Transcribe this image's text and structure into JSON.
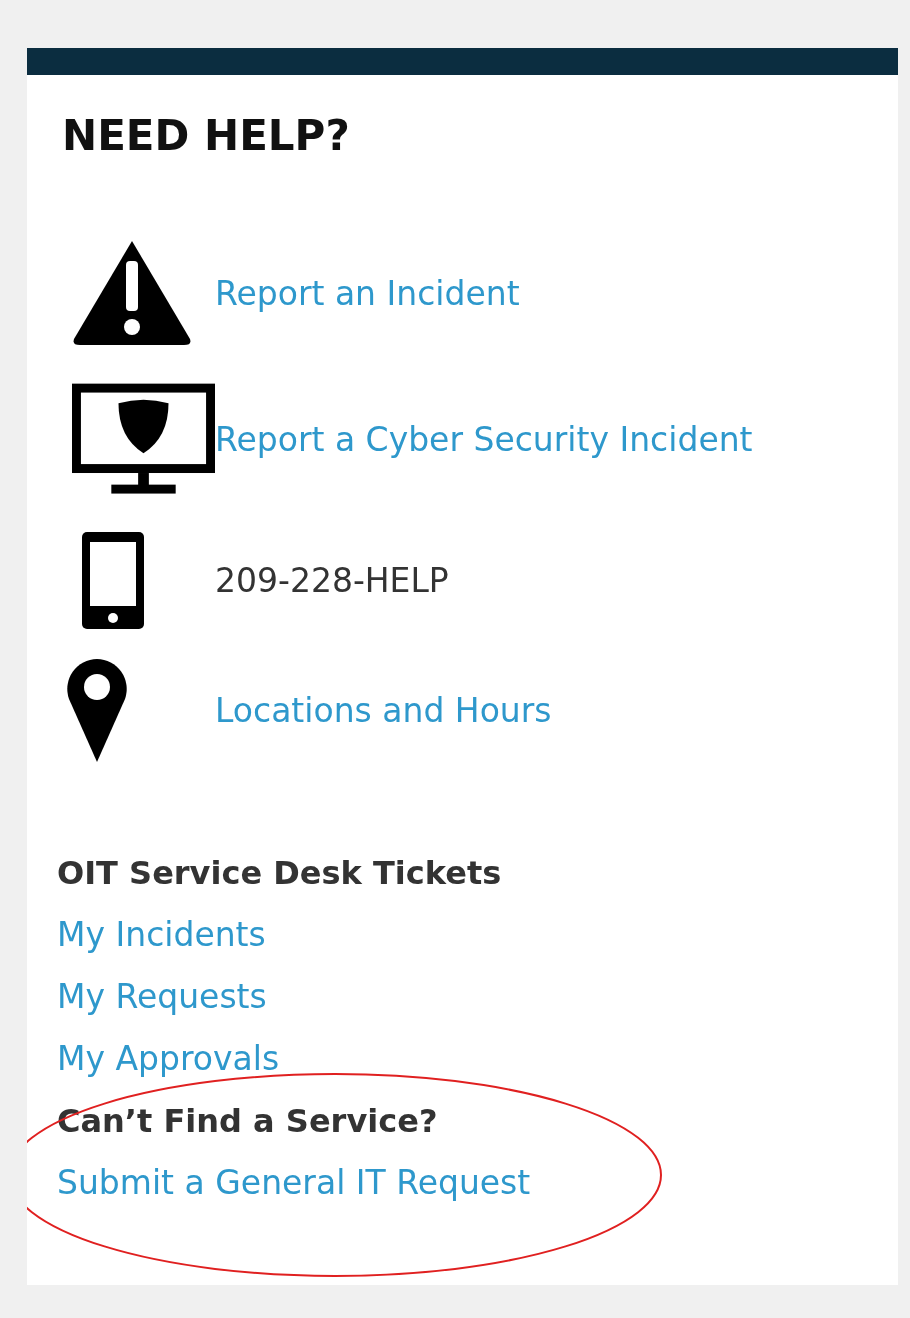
{
  "title": "NEED HELP?",
  "contacts": [
    {
      "kind": "link",
      "label": "Report an Incident"
    },
    {
      "kind": "link",
      "label": "Report a Cyber Security Incident"
    },
    {
      "kind": "text",
      "label": "209-228-HELP"
    },
    {
      "kind": "link",
      "label": "Locations and Hours"
    }
  ],
  "sections": [
    {
      "heading": "OIT Service Desk Tickets",
      "links": [
        "My Incidents",
        "My Requests",
        "My Approvals"
      ]
    },
    {
      "heading": "Can’t Find a Service?",
      "links": [
        "Submit a General IT Request"
      ]
    }
  ]
}
